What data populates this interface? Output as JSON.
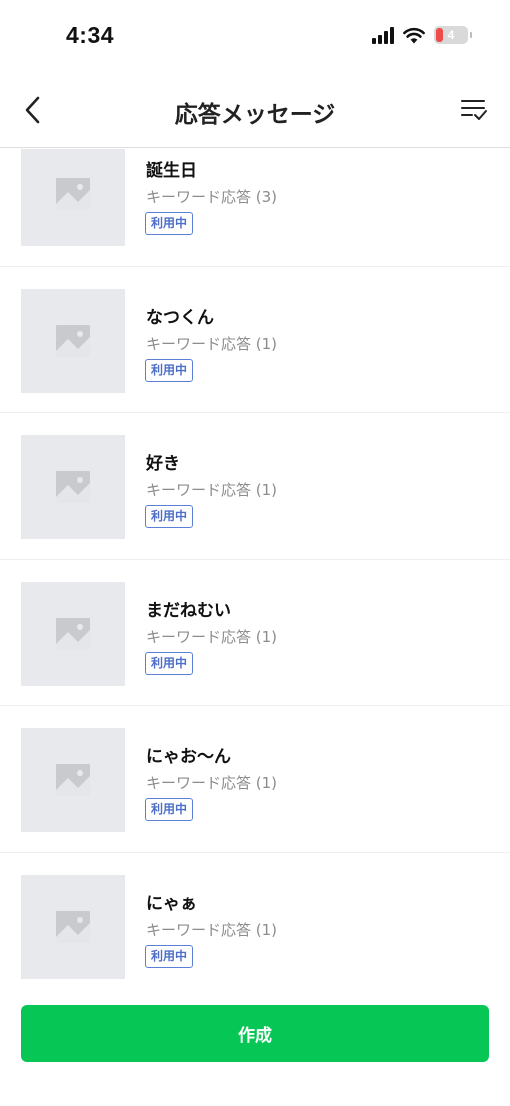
{
  "status_bar": {
    "time": "4:34",
    "battery_level": "4"
  },
  "nav": {
    "title": "応答メッセージ",
    "back_icon": "chevron-left-icon",
    "select_icon": "list-check-icon"
  },
  "items": [
    {
      "title": "誕生日",
      "subtitle": "キーワード応答 (3)",
      "badge": "利用中"
    },
    {
      "title": "なつくん",
      "subtitle": "キーワード応答 (1)",
      "badge": "利用中"
    },
    {
      "title": "好き",
      "subtitle": "キーワード応答 (1)",
      "badge": "利用中"
    },
    {
      "title": "まだねむい",
      "subtitle": "キーワード応答 (1)",
      "badge": "利用中"
    },
    {
      "title": "にゃお〜ん",
      "subtitle": "キーワード応答 (1)",
      "badge": "利用中"
    },
    {
      "title": "にゃぁ",
      "subtitle": "キーワード応答 (1)",
      "badge": "利用中"
    }
  ],
  "footer": {
    "create_label": "作成"
  },
  "colors": {
    "accent": "#06c755",
    "badge": "#4d6fc9",
    "thumb_bg": "#e8e9ec"
  }
}
